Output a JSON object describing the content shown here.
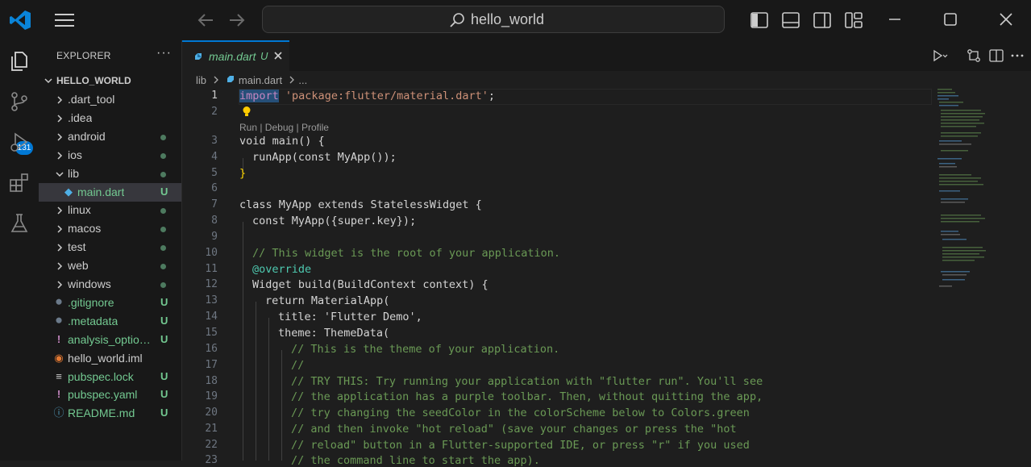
{
  "titlebar": {
    "search_text": "hello_world"
  },
  "activity_bar": {
    "items": [
      "explorer-icon",
      "source-control-icon",
      "run-debug-icon",
      "extensions-icon",
      "testing-icon"
    ],
    "source_control_badge": "131"
  },
  "sidebar": {
    "title": "EXPLORER",
    "more": "···",
    "root": "HELLO_WORLD",
    "items": [
      {
        "label": ".dart_tool",
        "kind": "folder",
        "status": ""
      },
      {
        "label": ".idea",
        "kind": "folder",
        "status": ""
      },
      {
        "label": "android",
        "kind": "folder",
        "status": "dot"
      },
      {
        "label": "ios",
        "kind": "folder",
        "status": "dot"
      },
      {
        "label": "lib",
        "kind": "folder-open",
        "status": "dot"
      },
      {
        "label": "main.dart",
        "kind": "dart-file",
        "status": "U"
      },
      {
        "label": "linux",
        "kind": "folder",
        "status": "dot"
      },
      {
        "label": "macos",
        "kind": "folder",
        "status": "dot"
      },
      {
        "label": "test",
        "kind": "folder",
        "status": "dot"
      },
      {
        "label": "web",
        "kind": "folder",
        "status": "dot"
      },
      {
        "label": "windows",
        "kind": "folder",
        "status": "dot"
      },
      {
        "label": ".gitignore",
        "kind": "file",
        "status": "U"
      },
      {
        "label": ".metadata",
        "kind": "file",
        "status": "U"
      },
      {
        "label": "analysis_options....",
        "kind": "yaml",
        "status": "U"
      },
      {
        "label": "hello_world.iml",
        "kind": "rss",
        "status": ""
      },
      {
        "label": "pubspec.lock",
        "kind": "lines",
        "status": "U"
      },
      {
        "label": "pubspec.yaml",
        "kind": "yaml",
        "status": "U"
      },
      {
        "label": "README.md",
        "kind": "info",
        "status": "U"
      }
    ]
  },
  "editor": {
    "tab": {
      "name": "main.dart",
      "status": "U"
    },
    "breadcrumb": [
      "lib",
      "main.dart",
      "..."
    ],
    "codelens": "Run | Debug | Profile",
    "line_numbers": [
      "1",
      "2",
      "3",
      "4",
      "5",
      "6",
      "7",
      "8",
      "9",
      "10",
      "11",
      "12",
      "13",
      "14",
      "15",
      "16",
      "17",
      "18",
      "19",
      "20",
      "21",
      "22",
      "23"
    ],
    "lines": {
      "l1_import": "import",
      "l1_rest": "'package:flutter/material.dart'",
      "l1_semi": ";",
      "l3": "void main() {",
      "l4": "runApp(const MyApp());",
      "l5": "}",
      "l7": "class MyApp extends StatelessWidget {",
      "l8": "const MyApp({super.key});",
      "l10": "// This widget is the root of your application.",
      "l11": "@override",
      "l12": "Widget build(BuildContext context) {",
      "l13": "return MaterialApp(",
      "l14": "title: 'Flutter Demo',",
      "l15": "theme: ThemeData(",
      "l16": "// This is the theme of your application.",
      "l17": "//",
      "l18": "// TRY THIS: Try running your application with \"flutter run\". You'll see",
      "l19": "// the application has a purple toolbar. Then, without quitting the app,",
      "l20": "// try changing the seedColor in the colorScheme below to Colors.green",
      "l21": "// and then invoke \"hot reload\" (save your changes or press the \"hot",
      "l22": "// reload\" button in a Flutter-supported IDE, or press \"r\" if you used",
      "l23": "// the command line to start the app)."
    }
  },
  "colors": {
    "accent": "#0078d4",
    "untracked": "#73c991",
    "keyword": "#569cd6",
    "string": "#ce9178",
    "type": "#4ec9b0",
    "comment": "#6a9955"
  }
}
